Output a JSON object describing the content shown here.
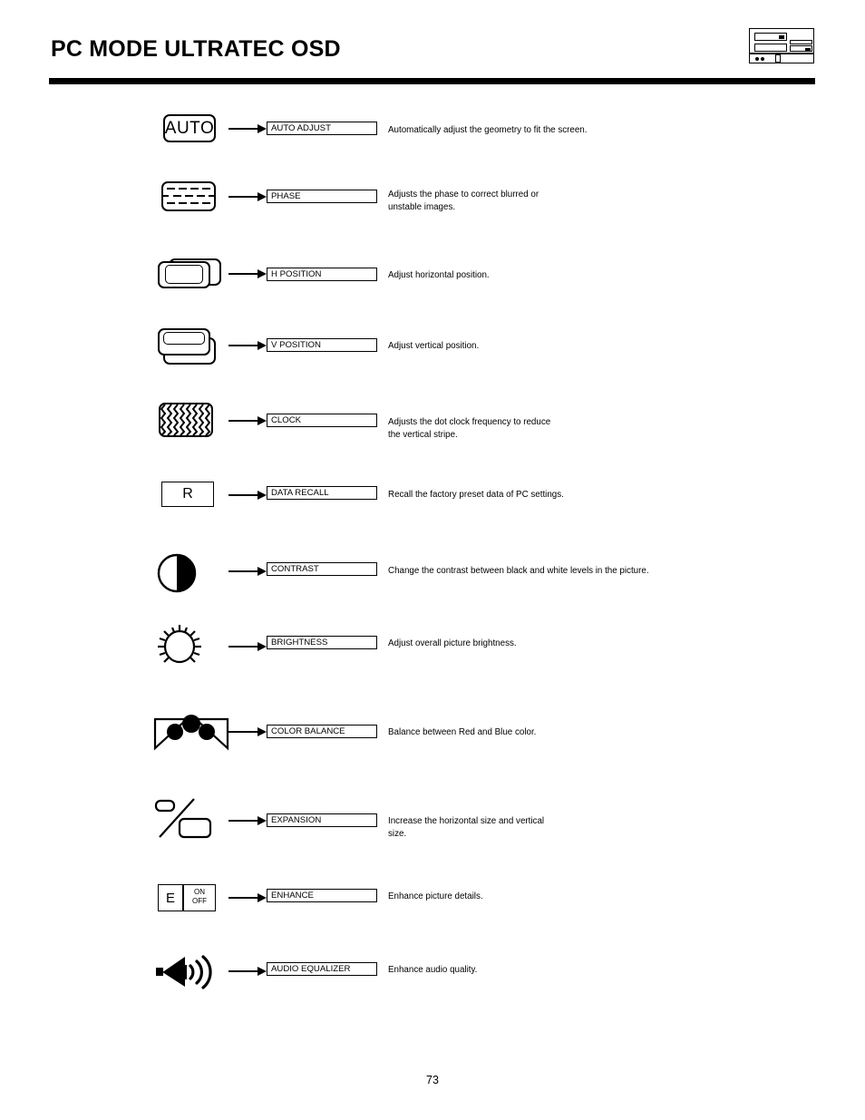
{
  "header": {
    "title": "PC MODE ULTRATEC OSD",
    "icon": "pc-tower-icon"
  },
  "footer": {
    "page_number": "73"
  },
  "rows": [
    {
      "icon": "auto-button-icon",
      "icon_text": "AUTO",
      "label": "AUTO ADJUST",
      "description": "Automatically adjust the geometry to fit the screen."
    },
    {
      "icon": "phase-dashed-screen-icon",
      "icon_text": "",
      "label": "PHASE",
      "description": "Adjusts the phase to correct blurred or\nunstable images."
    },
    {
      "icon": "h-position-icon",
      "icon_text": "",
      "label": "H POSITION",
      "description": "Adjust horizontal position."
    },
    {
      "icon": "v-position-icon",
      "icon_text": "",
      "label": "V POSITION",
      "description": "Adjust vertical position."
    },
    {
      "icon": "clock-zigzag-icon",
      "icon_text": "",
      "label": "CLOCK",
      "description": "Adjusts the dot clock frequency to reduce\nthe vertical stripe."
    },
    {
      "icon": "data-recall-icon",
      "icon_text": "R",
      "label": "DATA RECALL",
      "description": "Recall the factory preset data of PC settings."
    },
    {
      "icon": "contrast-half-circle-icon",
      "icon_text": "",
      "label": "CONTRAST",
      "description": "Change the contrast between black and white levels in the picture."
    },
    {
      "icon": "brightness-sun-icon",
      "icon_text": "",
      "label": "BRIGHTNESS",
      "description": "Adjust overall picture brightness."
    },
    {
      "icon": "color-balance-icon",
      "icon_text": "",
      "label": "COLOR BALANCE",
      "description": "Balance between Red and Blue color."
    },
    {
      "icon": "expansion-icon",
      "icon_text": "",
      "label": "EXPANSION",
      "description": "Increase the horizontal size and vertical\nsize."
    },
    {
      "icon": "enhance-on-off-icon",
      "icon_text": "E",
      "icon_on": "ON",
      "icon_off": "OFF",
      "label": "ENHANCE",
      "description": "Enhance picture details."
    },
    {
      "icon": "audio-equalizer-speaker-icon",
      "icon_text": "",
      "label": "AUDIO EQUALIZER",
      "description": "Enhance audio quality."
    }
  ],
  "colors": {
    "ink": "#000000",
    "paper": "#ffffff"
  }
}
